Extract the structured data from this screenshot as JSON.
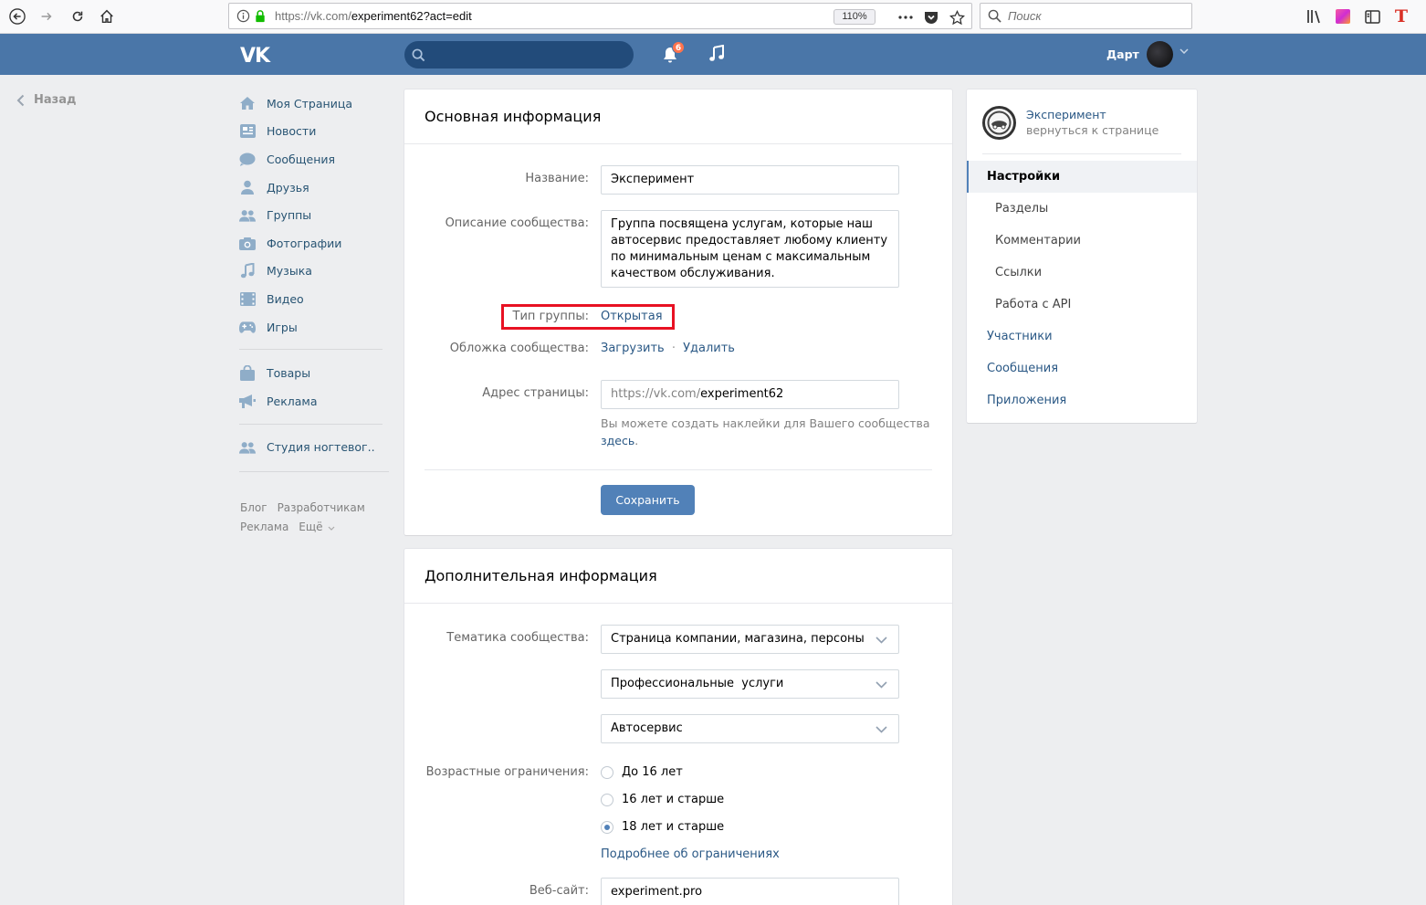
{
  "browser": {
    "url_prefix": "https://vk.com/",
    "url_path": "experiment62?act=edit",
    "zoom": "110%",
    "search_placeholder": "Поиск"
  },
  "header": {
    "logo": "VK",
    "notifications_count": "6",
    "user_name": "Дарт"
  },
  "back_label": "Назад",
  "left_menu": {
    "items": [
      {
        "label": "Моя Страница",
        "icon": "home-icon"
      },
      {
        "label": "Новости",
        "icon": "news-icon"
      },
      {
        "label": "Сообщения",
        "icon": "messages-icon"
      },
      {
        "label": "Друзья",
        "icon": "friends-icon"
      },
      {
        "label": "Группы",
        "icon": "groups-icon"
      },
      {
        "label": "Фотографии",
        "icon": "camera-icon"
      },
      {
        "label": "Музыка",
        "icon": "music-icon"
      },
      {
        "label": "Видео",
        "icon": "video-icon"
      },
      {
        "label": "Игры",
        "icon": "gamepad-icon"
      }
    ],
    "items2": [
      {
        "label": "Товары",
        "icon": "shop-bag-icon"
      },
      {
        "label": "Реклама",
        "icon": "megaphone-icon"
      }
    ],
    "items3": [
      {
        "label": "Студия ногтевог..",
        "icon": "community-icon"
      }
    ],
    "footer": [
      "Блог",
      "Разработчикам",
      "Реклама",
      "Ещё"
    ]
  },
  "basic_info": {
    "title": "Основная информация",
    "name_label": "Название:",
    "name_value": "Эксперимент",
    "desc_label": "Описание сообщества:",
    "desc_value": "Группа посвящена услугам, которые наш автосервис предоставляет любому клиенту по минимальным ценам с максимальным качеством обслуживания.",
    "type_label": "Тип группы:",
    "type_value": "Открытая",
    "cover_label": "Обложка сообщества:",
    "cover_upload": "Загрузить",
    "cover_sep": "·",
    "cover_delete": "Удалить",
    "address_label": "Адрес страницы:",
    "address_prefix": "https://vk.com/",
    "address_value": "experiment62",
    "sticker_hint": "Вы можете создать наклейки для Вашего сообщества",
    "sticker_link": "здесь",
    "save_label": "Сохранить"
  },
  "extra_info": {
    "title": "Дополнительная информация",
    "topic_label": "Тематика сообщества:",
    "topic1": "Страница компании, магазина, персоны",
    "topic2": "Профессиональные  услуги",
    "topic3": "Автосервис",
    "age_label": "Возрастные ограничения:",
    "age_options": [
      {
        "label": "До 16 лет",
        "selected": false
      },
      {
        "label": "16 лет и старше",
        "selected": false
      },
      {
        "label": "18 лет и старше",
        "selected": true
      }
    ],
    "age_more": "Подробнее об ограничениях",
    "website_label": "Веб-сайт:",
    "website_value": "experiment.pro"
  },
  "right_nav": {
    "group_name": "Эксперимент",
    "group_back": "вернуться к странице",
    "items": [
      {
        "label": "Настройки",
        "active": true
      },
      {
        "label": "Разделы",
        "sub": true
      },
      {
        "label": "Комментарии",
        "sub": true
      },
      {
        "label": "Ссылки",
        "sub": true
      },
      {
        "label": "Работа с API",
        "sub": true
      },
      {
        "label": "Участники"
      },
      {
        "label": "Сообщения"
      },
      {
        "label": "Приложения"
      }
    ]
  },
  "colors": {
    "vk_blue": "#4a76a8",
    "link": "#2a5885",
    "button": "#5181b8",
    "highlight": "#e81123"
  }
}
